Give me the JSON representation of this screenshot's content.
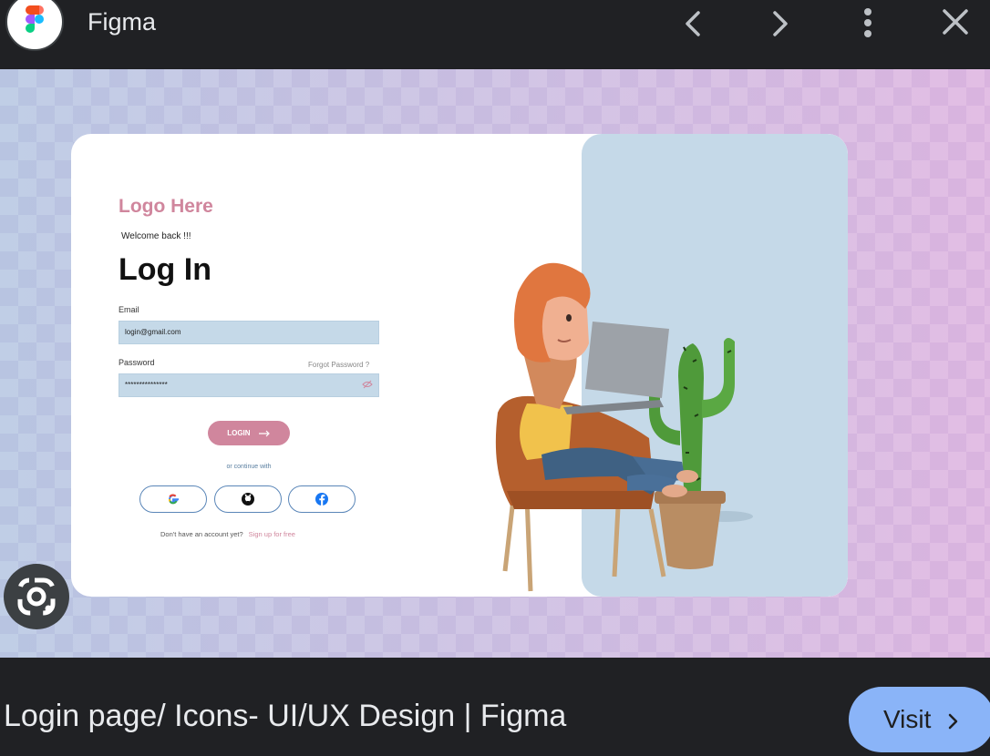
{
  "topbar": {
    "title": "Figma",
    "logo_icon": "figma-logo-icon",
    "icons": [
      "chevron-left-icon",
      "chevron-right-icon",
      "more-vert-icon",
      "close-icon"
    ]
  },
  "design": {
    "logo_text": "Logo Here",
    "welcome": "Welcome back !!!",
    "heading": "Log In",
    "email_label": "Email",
    "email_value": "login@gmail.com",
    "password_label": "Password",
    "forgot": "Forgot Password ?",
    "password_value": "***************",
    "login_button": "LOGIN",
    "continue_text": "or continue with",
    "social": [
      "google-icon",
      "github-icon",
      "facebook-icon"
    ],
    "signup_prompt": "Don't have an account yet?",
    "signup_link": "Sign up for free",
    "colors": {
      "accent": "#d0869d",
      "field": "#c5d9e8"
    }
  },
  "footer": {
    "caption": "Login page/ Icons- UI/UX Design | Figma",
    "visit_label": "Visit",
    "lens_icon": "google-lens-icon"
  }
}
